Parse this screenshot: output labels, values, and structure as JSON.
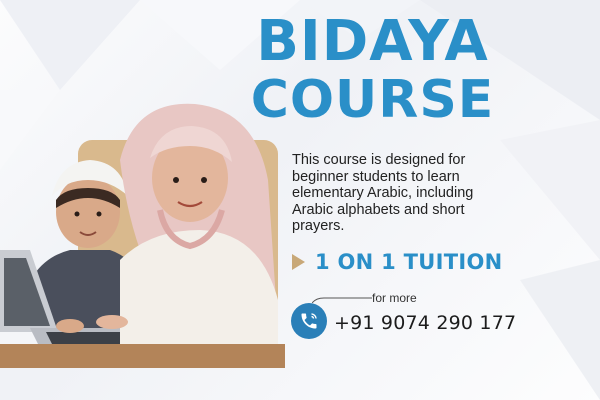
{
  "banner": {
    "title_line1": "BIDAYA",
    "title_line2": "COURSE",
    "description": "This course is designed for beginner students to learn elementary Arabic, including Arabic alphabets and short prayers.",
    "tuition_label": "1 ON 1 TUITION",
    "contact_prompt": "for more",
    "phone_number": "+91 9074 290 177",
    "icons": {
      "tuition_marker": "play-triangle-icon",
      "contact": "phone-icon"
    },
    "colors": {
      "accent_blue": "#2a8fc8",
      "phone_circle": "#2a7fb8",
      "marker_tan": "#c8a878",
      "photo_backdrop": "#d9b98d"
    }
  }
}
